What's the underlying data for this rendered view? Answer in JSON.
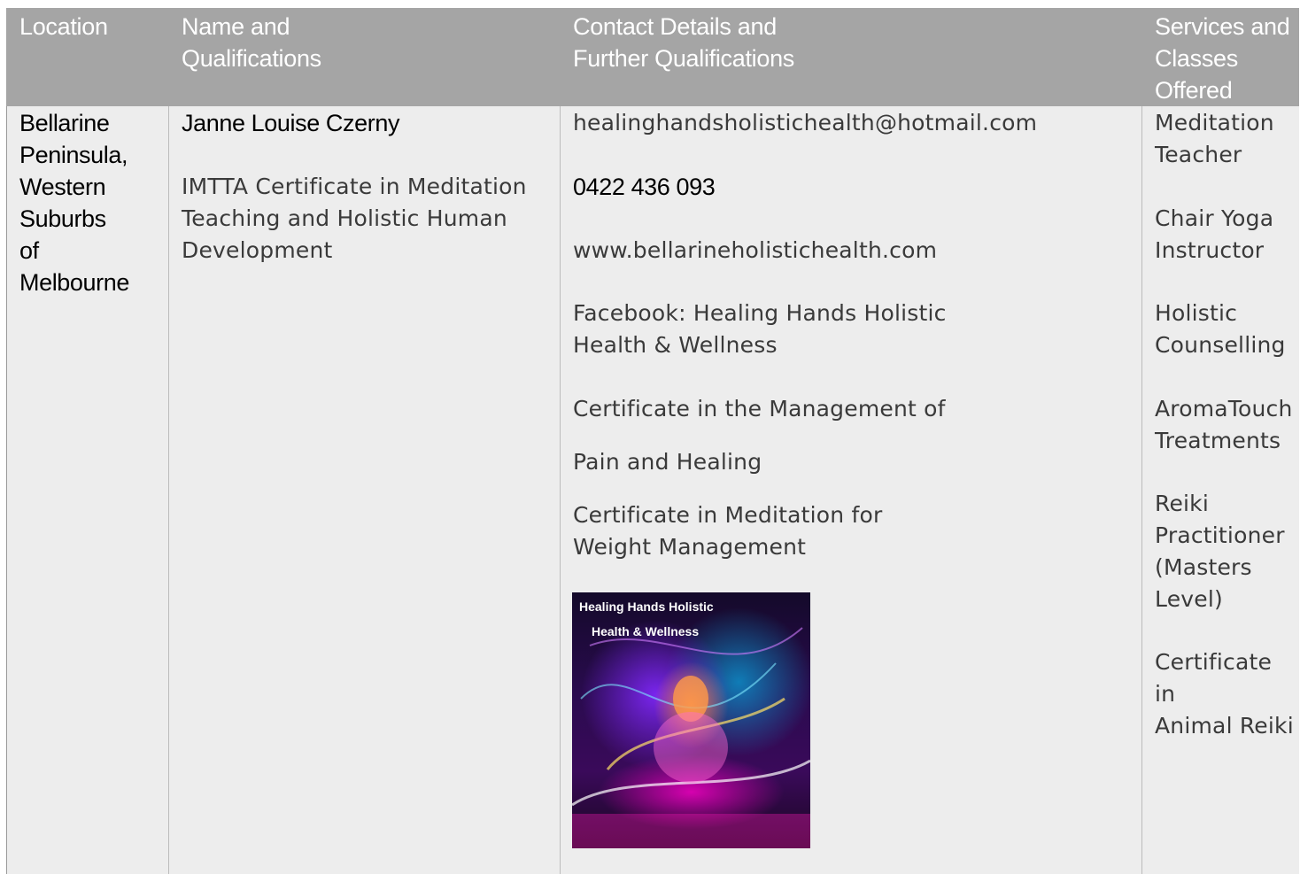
{
  "header": {
    "location": "Location",
    "name": "Name and\nQualifications",
    "contact": "Contact Details and\nFurther Qualifications",
    "services": "Services and\nClasses\nOffered"
  },
  "row": {
    "location": "Bellarine\nPeninsula,\nWestern\nSuburbs\nof\nMelbourne",
    "name": "Janne Louise Czerny",
    "qualification": "IMTTA Certificate in Meditation\nTeaching and Holistic Human\nDevelopment",
    "email": "healinghandsholistichealth@hotmail.com",
    "phone": "0422 436 093",
    "website": "www.bellarineholistichealth.com",
    "facebook": "Facebook: Healing Hands Holistic\nHealth & Wellness",
    "cert_pain_1": "Certificate in the Management of",
    "cert_pain_2": "Pain and Healing",
    "cert_meditation": "Certificate in Meditation for\nWeight Management",
    "image_caption_1": "Healing Hands Holistic",
    "image_caption_2": "Health & Wellness",
    "services": [
      "Meditation\nTeacher",
      "Chair Yoga\nInstructor",
      "Holistic\nCounselling",
      "AromaTouch\nTreatments",
      "Reiki\nPractitioner\n(Masters\nLevel)",
      "Certificate in\nAnimal Reiki"
    ]
  }
}
